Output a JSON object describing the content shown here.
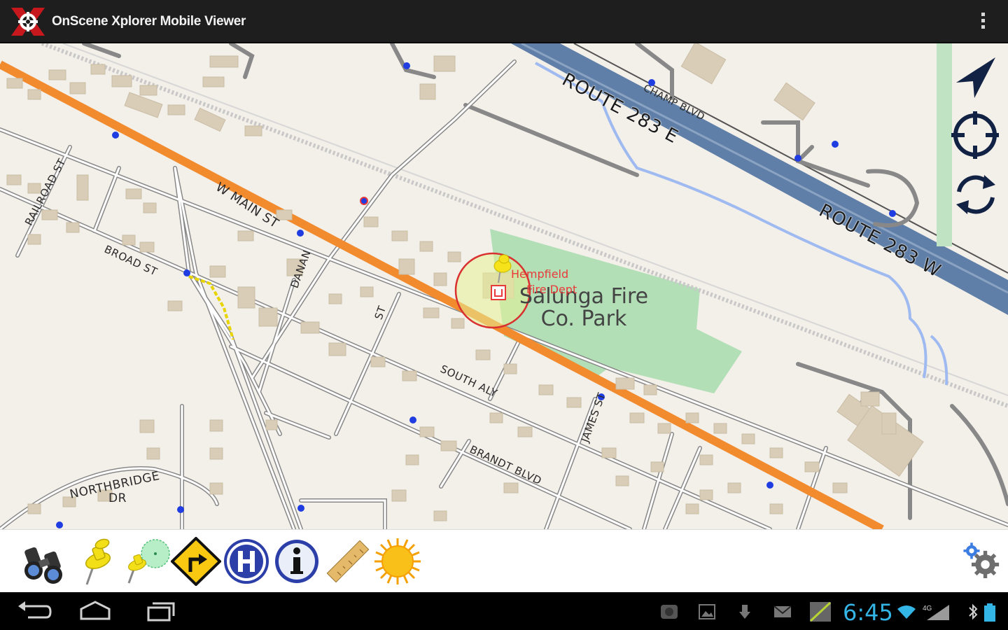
{
  "app": {
    "title": "OnScene Xplorer Mobile Viewer",
    "logo_icon": "onscene-x-logo",
    "menu_icon": "overflow-menu-icon"
  },
  "map": {
    "road_labels": {
      "w_main_st": "W MAIN ST",
      "railroad_st": "RAILROAD ST",
      "broad_st": "BROAD ST",
      "danan": "DANAN",
      "cross_st": "ST",
      "south_alley": "SOUTH ALY",
      "brandt_blvd": "BRANDT BLVD",
      "james_st": "JAMES ST",
      "northbridge_dr_1": "NORTHBRIDGE",
      "northbridge_dr_2": "DR",
      "champ_blvd": "CHAMP BLVD",
      "route_283_e": "ROUTE 283 E",
      "route_283_w": "ROUTE 283 W"
    },
    "park_label": "Salunga Fire Co. Park",
    "poi_label_line1": "Hempfield",
    "poi_label_line2": "Fire Dept",
    "controls": {
      "navigate": "navigation-arrow-icon",
      "locate": "gps-locate-icon",
      "refresh": "refresh-icon"
    },
    "colors": {
      "background": "#f3efe9",
      "main_road": "#f28a2e",
      "highway": "#5f7fa8",
      "park": "#b2dfb6",
      "water": "#9fbaf0",
      "building": "#d9cdb8",
      "selection_ring": "#d93030"
    }
  },
  "toolbar": {
    "tools": [
      {
        "name": "binoculars-icon"
      },
      {
        "name": "pushpin-icon"
      },
      {
        "name": "pin-radius-icon"
      },
      {
        "name": "turn-right-sign-icon"
      },
      {
        "name": "hospital-icon"
      },
      {
        "name": "info-icon"
      },
      {
        "name": "ruler-icon"
      },
      {
        "name": "sun-icon"
      }
    ],
    "settings_icon": "settings-gears-icon"
  },
  "system": {
    "clock": "6:45",
    "network": "4G",
    "nav_buttons": [
      "back-icon",
      "home-icon",
      "recent-apps-icon"
    ],
    "status_icons": [
      "app-notification-icon",
      "image-icon",
      "download-icon",
      "gmail-icon",
      "signal-chart-icon",
      "wifi-icon",
      "cell-signal-icon",
      "bluetooth-icon",
      "battery-icon"
    ]
  }
}
